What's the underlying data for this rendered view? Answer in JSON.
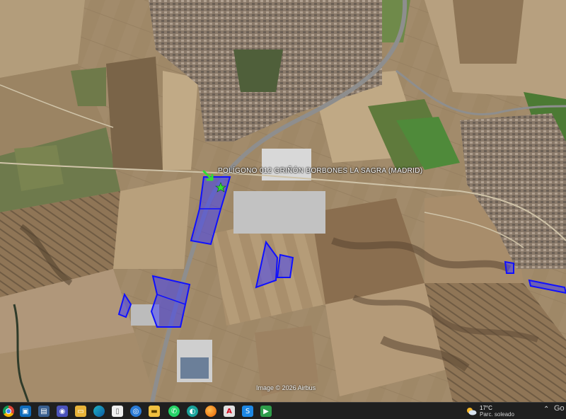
{
  "map": {
    "place_label": "POLÍGONO 012 GRIÑÓN BORBONES LA SAGRA (MADRID)",
    "attribution": "Image © 2026 Airbus",
    "colors": {
      "parcel_fill": "#3a3aff",
      "parcel_stroke": "#1010ff",
      "marker": "#33dd33"
    }
  },
  "taskbar": {
    "icons": [
      "chrome-icon",
      "outlook-icon",
      "photos-icon",
      "teams-icon",
      "file-explorer-icon",
      "edge-icon",
      "file-icon",
      "maps-icon",
      "explorer-icon",
      "whatsapp-icon",
      "camera-icon",
      "firefox-icon",
      "acrobat-icon",
      "shop-icon",
      "app-icon"
    ],
    "weather": {
      "temperature": "17°C",
      "condition": "Parc. soleado"
    },
    "corner": "Go"
  }
}
